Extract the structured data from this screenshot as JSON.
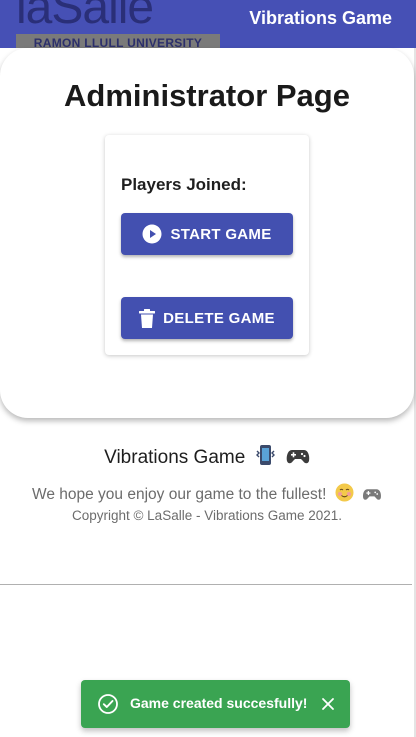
{
  "header": {
    "logo_text": "laSalle",
    "logo_subtitle": "RAMON LLULL UNIVERSITY",
    "app_title": "Vibrations Game"
  },
  "main": {
    "title": "Administrator Page",
    "players_label": "Players Joined:",
    "start_button": {
      "label": "START GAME",
      "icon": "play-circle-icon"
    },
    "delete_button": {
      "label": "DELETE GAME",
      "icon": "trash-icon"
    }
  },
  "footer": {
    "title": "Vibrations Game",
    "title_emojis": [
      "phone-vibrate-icon",
      "gamepad-icon"
    ],
    "tagline": "We hope you enjoy our game to the fullest!",
    "tagline_emojis": [
      "smiling-face-icon",
      "gamepad-icon"
    ],
    "copyright": "Copyright © LaSalle - Vibrations Game 2021."
  },
  "toast": {
    "message": "Game created succesfully!",
    "status": "success",
    "icon": "check-circle-icon",
    "close_icon": "close-icon"
  },
  "colors": {
    "primary": "#4350b0",
    "header": "#4650b5",
    "toast_success": "#3aa452"
  }
}
